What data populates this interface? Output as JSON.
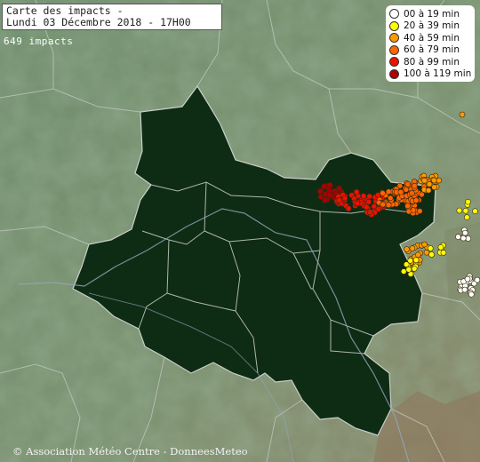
{
  "map": {
    "title_line1": "Carte des impacts -",
    "title_line2": "Lundi 03 Décembre 2018 - 17H00",
    "impact_count": "649 impacts",
    "credit": "© Association Météo Centre - DonneesMeteo",
    "colors": {
      "background_land": "#6f8a6c",
      "region": "#0d2a12",
      "borders": "#bfc6c0",
      "rivers": "#8fa4ba"
    },
    "legend": [
      {
        "label": "00 à 19 min",
        "color": "#ffffff"
      },
      {
        "label": "20 à 39 min",
        "color": "#ffff00"
      },
      {
        "label": "40 à 59 min",
        "color": "#ff9900"
      },
      {
        "label": "60 à 79 min",
        "color": "#ff6600"
      },
      {
        "label": "80 à 99 min",
        "color": "#ee1100"
      },
      {
        "label": "100 à 119 min",
        "color": "#aa0000"
      }
    ]
  }
}
